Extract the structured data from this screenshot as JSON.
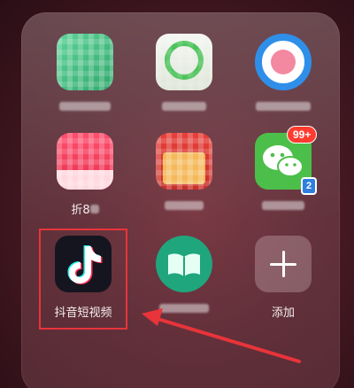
{
  "folder": {
    "apps": [
      {
        "label": "",
        "icon": "green-app-icon"
      },
      {
        "label": "",
        "icon": "green-white-app-icon"
      },
      {
        "label": "",
        "icon": "blue-circle-app-icon"
      },
      {
        "label": "折8",
        "icon": "pink-shopping-app-icon"
      },
      {
        "label": "",
        "icon": "red-gift-app-icon"
      },
      {
        "label": "",
        "icon": "wechat-icon",
        "badge": "99+"
      },
      {
        "label": "抖音短视频",
        "icon": "tiktok-icon"
      },
      {
        "label": "",
        "icon": "book-app-icon"
      },
      {
        "label": "添加",
        "icon": "plus-icon"
      }
    ]
  },
  "colors": {
    "highlight": "#e8343a",
    "wechat_green": "#4cbf4a",
    "tiktok_bg": "#151520"
  }
}
